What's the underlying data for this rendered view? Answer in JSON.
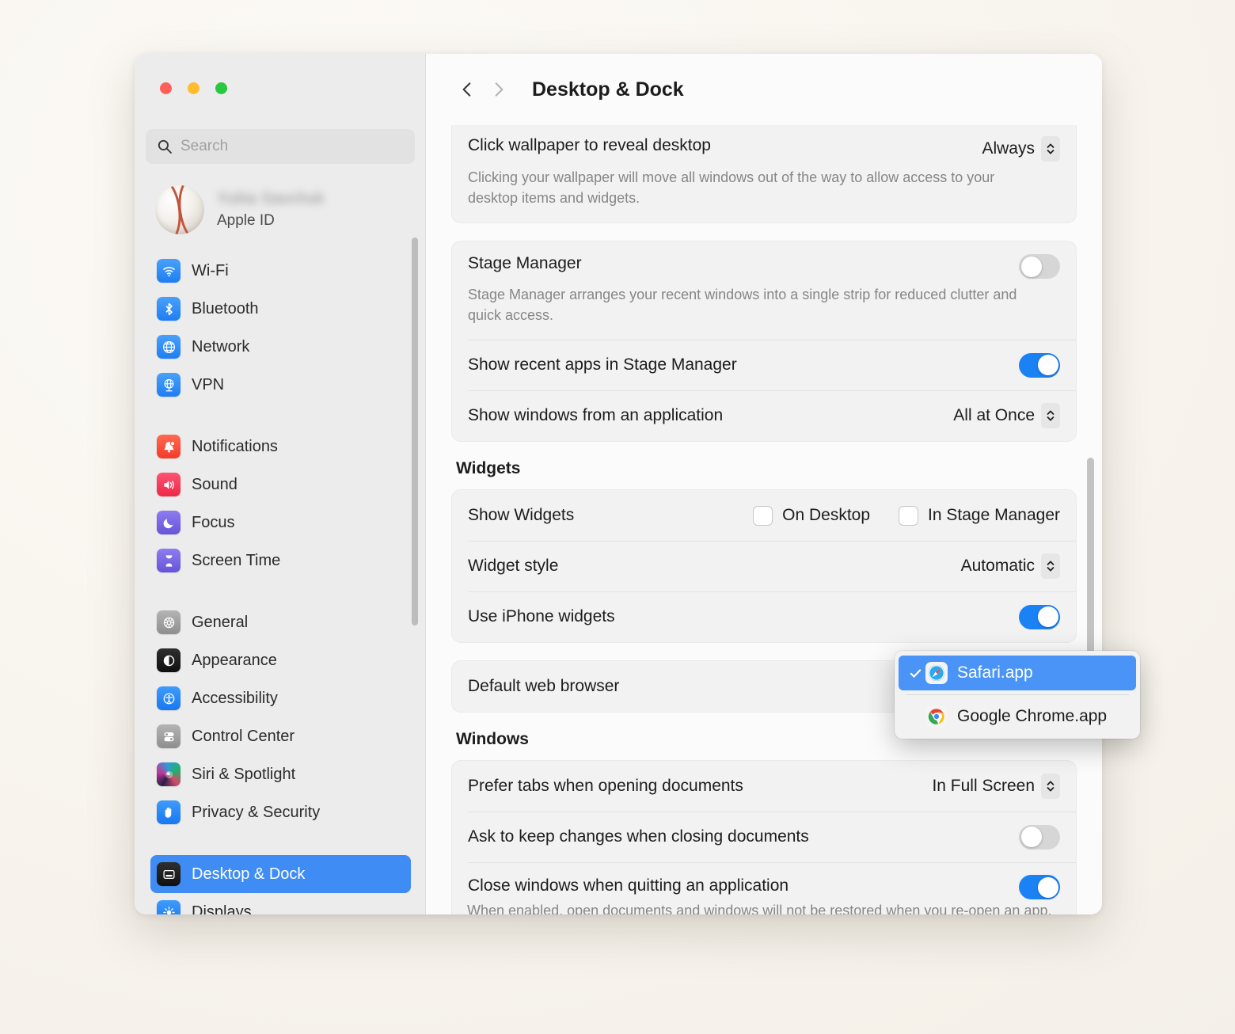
{
  "window": {
    "traffic_lights": [
      "close",
      "minimize",
      "zoom"
    ],
    "colors": {
      "red": "#ff5f57",
      "yellow": "#febc2e",
      "green": "#28c840",
      "accent": "#1b82f5",
      "selection": "#3f8cf4"
    }
  },
  "sidebar": {
    "search": {
      "placeholder": "Search",
      "value": ""
    },
    "account": {
      "name": "Yuliia Savchuk",
      "subtitle": "Apple ID"
    },
    "groups": [
      {
        "items": [
          {
            "label": "Wi-Fi",
            "icon": "wifi-icon",
            "selected": false
          },
          {
            "label": "Bluetooth",
            "icon": "bluetooth-icon",
            "selected": false
          },
          {
            "label": "Network",
            "icon": "network-icon",
            "selected": false
          },
          {
            "label": "VPN",
            "icon": "vpn-icon",
            "selected": false
          }
        ]
      },
      {
        "items": [
          {
            "label": "Notifications",
            "icon": "bell-icon",
            "selected": false
          },
          {
            "label": "Sound",
            "icon": "speaker-icon",
            "selected": false
          },
          {
            "label": "Focus",
            "icon": "moon-icon",
            "selected": false
          },
          {
            "label": "Screen Time",
            "icon": "hourglass-icon",
            "selected": false
          }
        ]
      },
      {
        "items": [
          {
            "label": "General",
            "icon": "gear-icon",
            "selected": false
          },
          {
            "label": "Appearance",
            "icon": "appearance-icon",
            "selected": false
          },
          {
            "label": "Accessibility",
            "icon": "accessibility-icon",
            "selected": false
          },
          {
            "label": "Control Center",
            "icon": "control-center-icon",
            "selected": false
          },
          {
            "label": "Siri & Spotlight",
            "icon": "siri-icon",
            "selected": false
          },
          {
            "label": "Privacy & Security",
            "icon": "hand-icon",
            "selected": false
          }
        ]
      },
      {
        "items": [
          {
            "label": "Desktop & Dock",
            "icon": "desktop-dock-icon",
            "selected": true
          },
          {
            "label": "Displays",
            "icon": "displays-icon",
            "selected": false
          }
        ]
      }
    ]
  },
  "header": {
    "title": "Desktop & Dock",
    "back": "back",
    "forward": "forward"
  },
  "main": {
    "click_wallpaper": {
      "label": "Click wallpaper to reveal desktop",
      "value": "Always",
      "description": "Clicking your wallpaper will move all windows out of the way to allow access to your desktop items and widgets."
    },
    "stage_manager": {
      "label": "Stage Manager",
      "description": "Stage Manager arranges your recent windows into a single strip for reduced clutter and quick access.",
      "enabled": false
    },
    "show_recent_apps": {
      "label": "Show recent apps in Stage Manager",
      "enabled": true
    },
    "show_windows": {
      "label": "Show windows from an application",
      "value": "All at Once"
    },
    "widgets_section": {
      "title": "Widgets"
    },
    "show_widgets": {
      "label": "Show Widgets",
      "options": [
        {
          "label": "On Desktop",
          "checked": false
        },
        {
          "label": "In Stage Manager",
          "checked": false
        }
      ]
    },
    "widget_style": {
      "label": "Widget style",
      "value": "Automatic"
    },
    "use_iphone_widgets": {
      "label": "Use iPhone widgets",
      "enabled": true
    },
    "default_web_browser": {
      "label": "Default web browser"
    },
    "windows_section": {
      "title": "Windows"
    },
    "prefer_tabs": {
      "label": "Prefer tabs when opening documents",
      "value": "In Full Screen"
    },
    "ask_to_keep": {
      "label": "Ask to keep changes when closing documents",
      "enabled": false
    },
    "close_windows": {
      "label": "Close windows when quitting an application",
      "description": "When enabled, open documents and windows will not be restored when you re-open an app."
    }
  },
  "dropdown": {
    "items": [
      {
        "label": "Safari.app",
        "icon": "safari-icon",
        "selected": true
      },
      {
        "label": "Google Chrome.app",
        "icon": "chrome-icon",
        "selected": false
      }
    ]
  }
}
